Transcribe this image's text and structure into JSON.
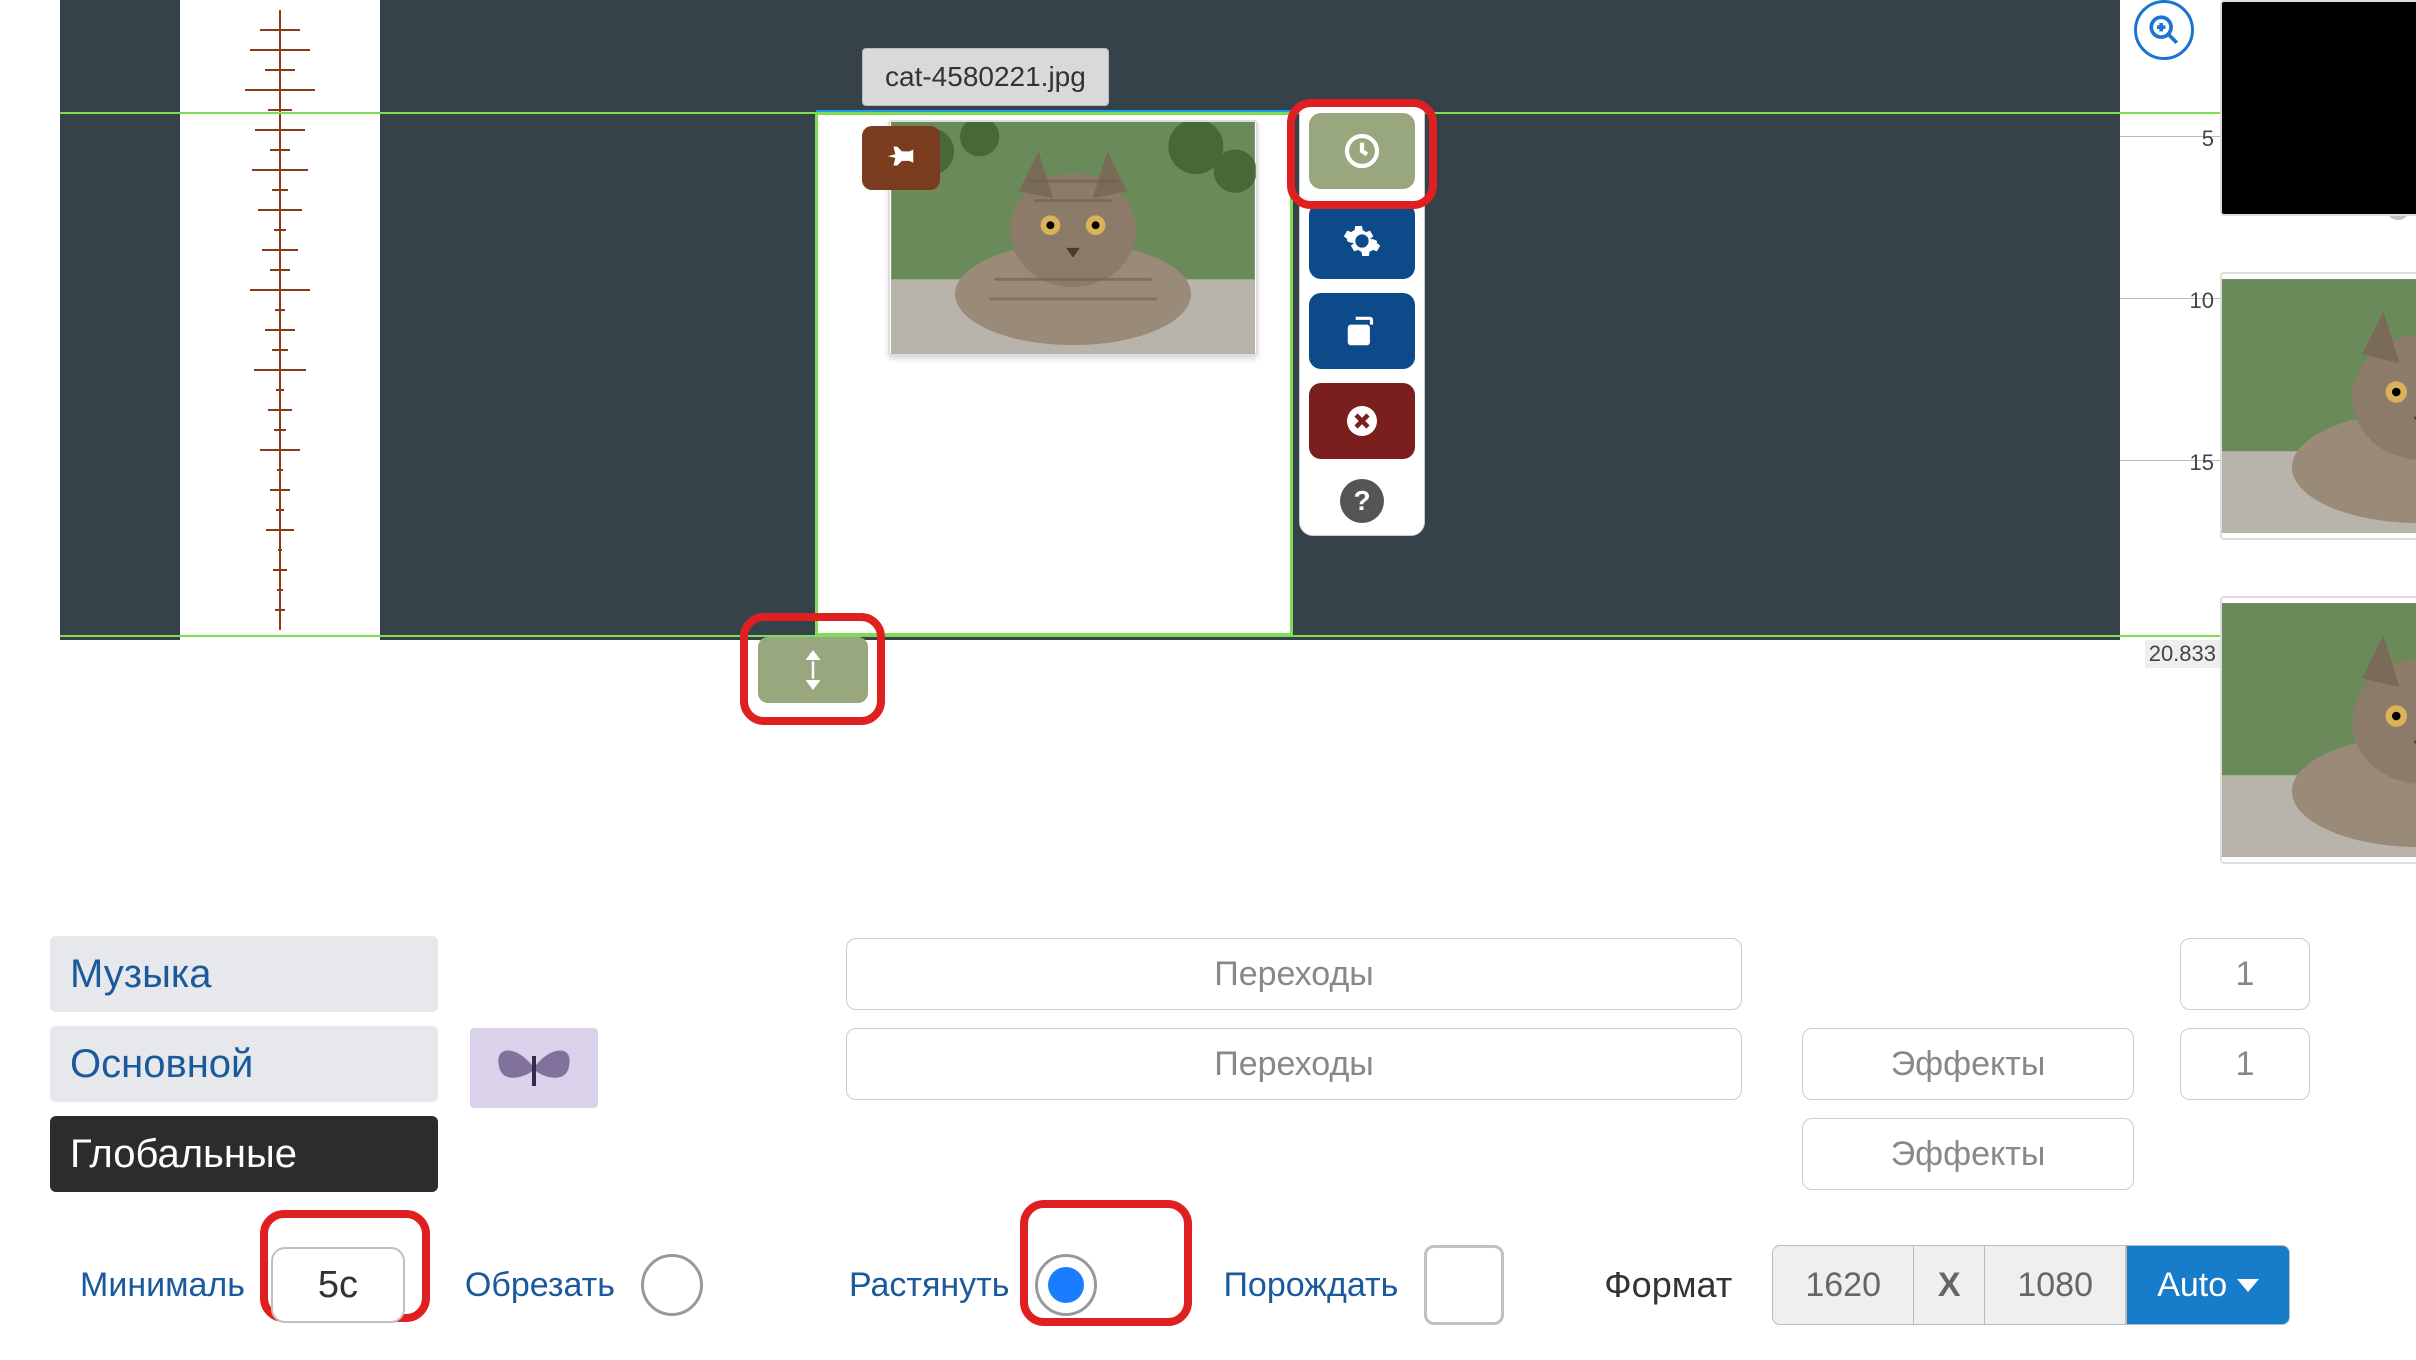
{
  "filename_tooltip": "cat-4580221.jpg",
  "ruler": {
    "t5": "5",
    "t10": "10",
    "t15": "15",
    "t_end": "20.833"
  },
  "tabs": {
    "music": "Музыка",
    "main": "Основной",
    "global": "Глобальные"
  },
  "transitions_label": "Переходы",
  "effects_label": "Эффекты",
  "counts": {
    "c1": "1",
    "c2": "1"
  },
  "params": {
    "min_label": "Минималь",
    "duration_value": "5с",
    "crop_label": "Обрезать",
    "stretch_label": "Растянуть",
    "spawn_label": "Порождать",
    "format_label": "Формат",
    "width": "1620",
    "sep": "X",
    "height": "1080",
    "auto": "Auto"
  },
  "icons": {
    "pin": "📌",
    "clock": "🕘",
    "gear": "⚙",
    "copy": "⧉",
    "delete": "✖",
    "help": "?",
    "resize_v": "↕",
    "zoom": "🔍+"
  }
}
